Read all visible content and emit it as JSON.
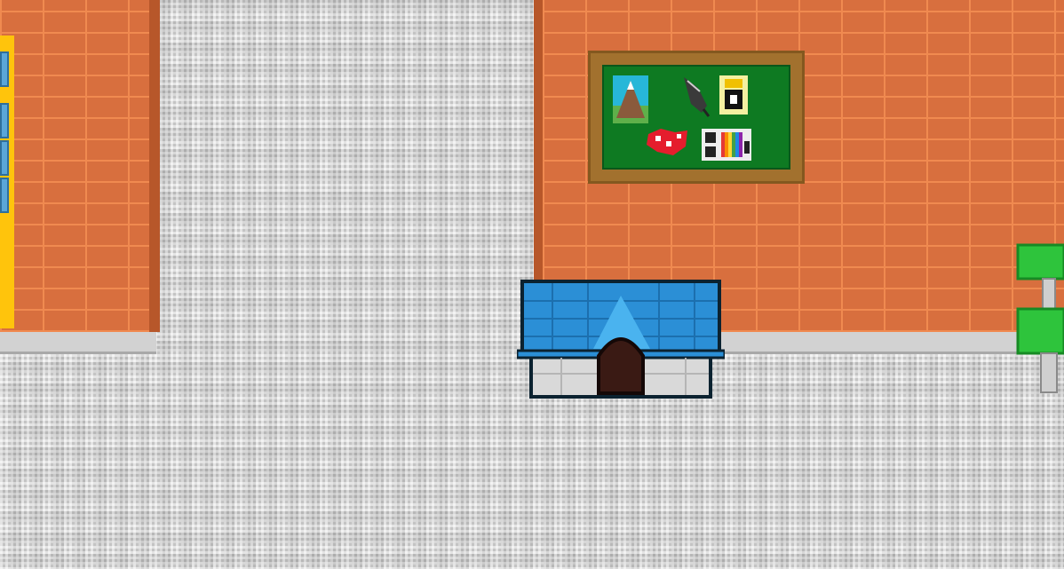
{
  "scene": {
    "name": "school-hallway",
    "colors": {
      "floor": "#c4c4c4",
      "brick": "#d86f3e",
      "mortar": "#f08a50",
      "door_trim": "#ffc40c",
      "board_frame": "#a2712e",
      "board_surface": "#0e7a22",
      "doghouse_roof": "#2b8fd6",
      "stool": "#2ec43c"
    },
    "objects": {
      "bulletin_board": {
        "pinned_items": [
          "mountain-photo",
          "feather-quill",
          "tower-card",
          "red-splotch-note",
          "rainbow-card"
        ]
      },
      "doghouse": {},
      "green_stool": {},
      "yellow_door": {}
    }
  }
}
